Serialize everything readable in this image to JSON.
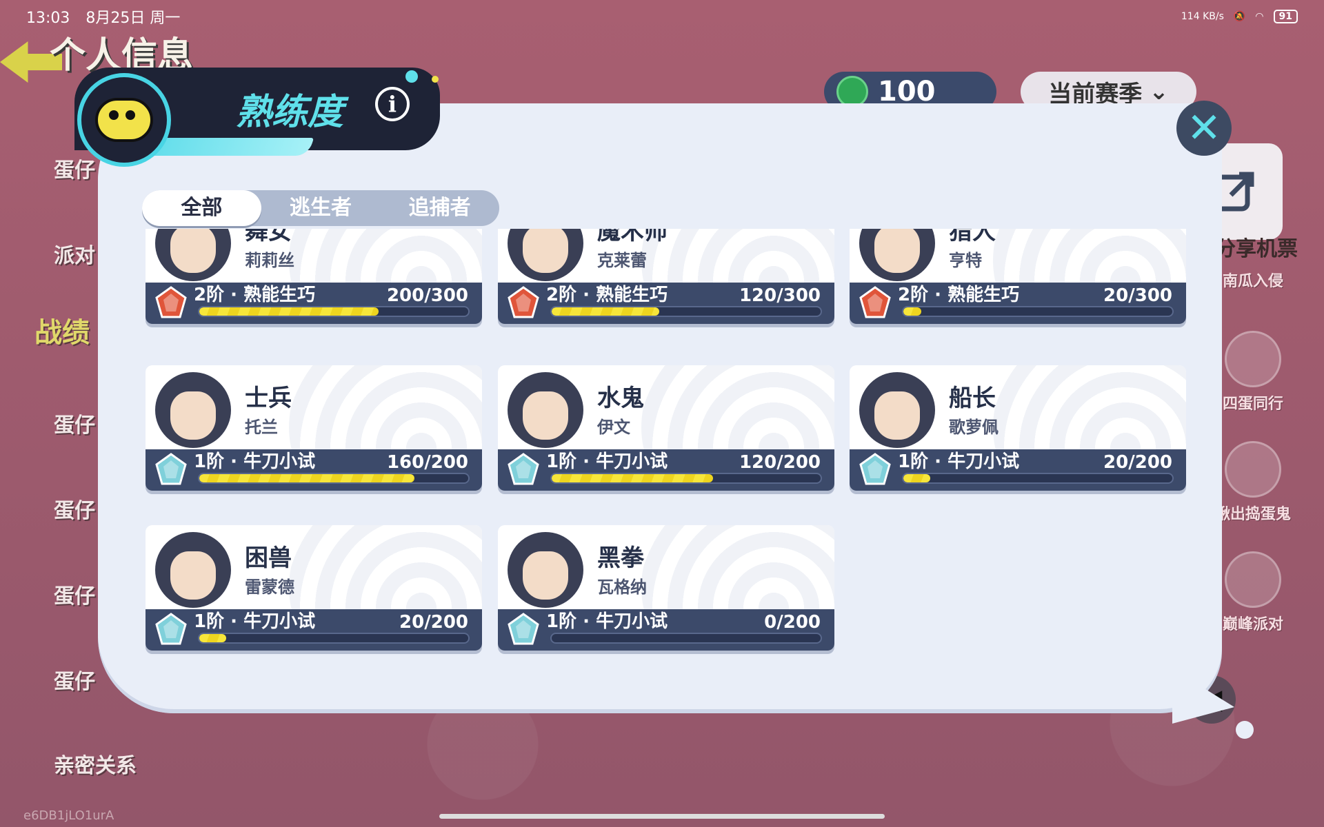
{
  "status_bar": {
    "time": "13:03",
    "date": "8月25日 周一",
    "net_speed": "114 KB/s",
    "battery": "91"
  },
  "background": {
    "page_title": "个人信息",
    "left_menu": [
      "蛋仔",
      "派对",
      "战绩",
      "蛋仔",
      "蛋仔",
      "蛋仔",
      "蛋仔",
      "亲密关系"
    ],
    "coins": "100",
    "season_label": "当前赛季",
    "share_label": "分享机票",
    "right_items": [
      "南瓜入侵",
      "四蛋同行",
      "揪出捣蛋鬼",
      "巅峰派对"
    ],
    "uid": "e6DB1jLO1urA"
  },
  "modal": {
    "title": "熟练度",
    "tabs": [
      "全部",
      "逃生者",
      "追捕者"
    ],
    "active_tab": 0,
    "cards": [
      {
        "role": "舞女",
        "name": "莉莉丝",
        "rank": "2阶 · 熟能生巧",
        "progress": "200/300",
        "value": 200,
        "max": 300,
        "tier": 2
      },
      {
        "role": "魔术师",
        "name": "克莱蕾",
        "rank": "2阶 · 熟能生巧",
        "progress": "120/300",
        "value": 120,
        "max": 300,
        "tier": 2
      },
      {
        "role": "猎人",
        "name": "亨特",
        "rank": "2阶 · 熟能生巧",
        "progress": "20/300",
        "value": 20,
        "max": 300,
        "tier": 2
      },
      {
        "role": "士兵",
        "name": "托兰",
        "rank": "1阶 · 牛刀小试",
        "progress": "160/200",
        "value": 160,
        "max": 200,
        "tier": 1
      },
      {
        "role": "水鬼",
        "name": "伊文",
        "rank": "1阶 · 牛刀小试",
        "progress": "120/200",
        "value": 120,
        "max": 200,
        "tier": 1
      },
      {
        "role": "船长",
        "name": "歌萝佩",
        "rank": "1阶 · 牛刀小试",
        "progress": "20/200",
        "value": 20,
        "max": 200,
        "tier": 1
      },
      {
        "role": "困兽",
        "name": "雷蒙德",
        "rank": "1阶 · 牛刀小试",
        "progress": "20/200",
        "value": 20,
        "max": 200,
        "tier": 1
      },
      {
        "role": "黑拳",
        "name": "瓦格纳",
        "rank": "1阶 · 牛刀小试",
        "progress": "0/200",
        "value": 0,
        "max": 200,
        "tier": 1
      }
    ]
  },
  "colors": {
    "accent": "#5fe0ea",
    "tier2": "#e0553a",
    "tier1": "#7fd0da",
    "bar": "#f2e03a"
  }
}
